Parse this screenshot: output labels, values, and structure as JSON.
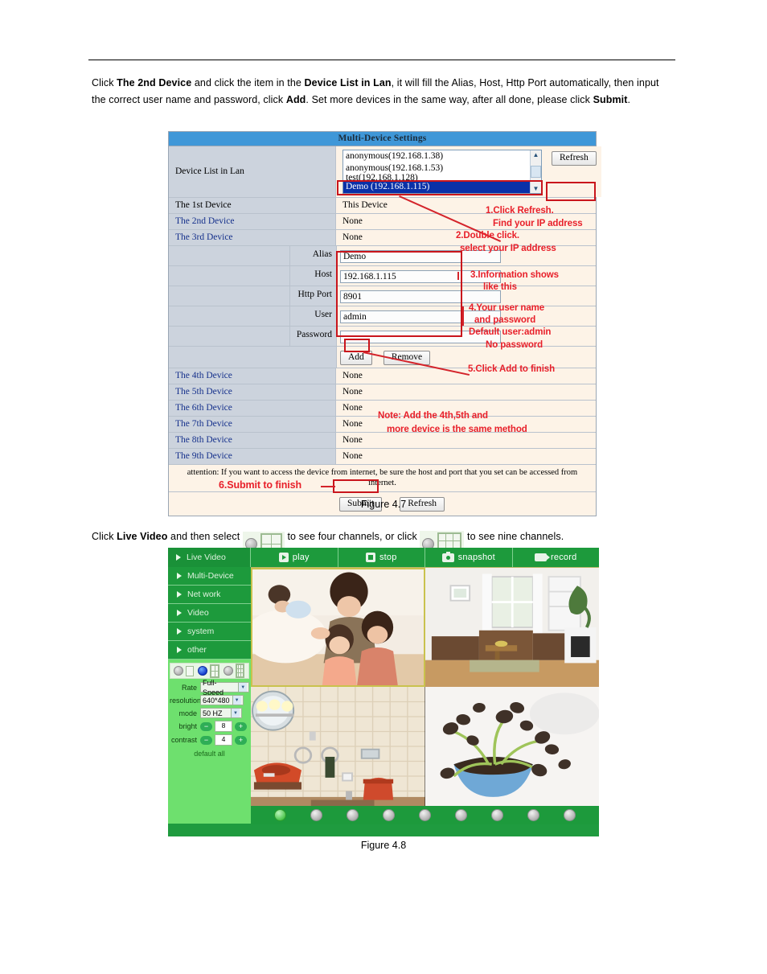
{
  "document": {
    "intro_paragraph": {
      "segments": [
        {
          "t": "Click ",
          "b": false
        },
        {
          "t": "The 2nd Device",
          "b": true
        },
        {
          "t": " and click the item in the ",
          "b": false
        },
        {
          "t": "Device List in Lan",
          "b": true
        },
        {
          "t": ", it will fill the Alias, Host, Http Port automatically, then input the correct user name and password, click ",
          "b": false
        },
        {
          "t": "Add",
          "b": true
        },
        {
          "t": ". Set more devices in the same way, after all done, please click ",
          "b": false
        },
        {
          "t": "Submit",
          "b": true
        },
        {
          "t": ".",
          "b": false
        }
      ]
    },
    "live_paragraph": {
      "before_first_icon": "Click ",
      "bold_live_video": "Live Video",
      "after_bold": " and then select ",
      "between_icons": " to see four channels, or click ",
      "after_second_icon": " to see nine channels."
    },
    "figure_47_caption": "Figure 4.7",
    "figure_48_caption": "Figure 4.8"
  },
  "multi_device": {
    "title": "Multi-Device Settings",
    "device_list_label": "Device List in Lan",
    "device_list_options": [
      "anonymous(192.168.1.38)",
      "anonymous(192.168.1.53)",
      "test(192.168.1.128)",
      "Demo (192.168.1.115)"
    ],
    "device_list_selected": "Demo (192.168.1.115)",
    "refresh_label": "Refresh",
    "devices": [
      {
        "label": "The 1st Device",
        "value": "This Device",
        "is_link": false
      },
      {
        "label": "The 2nd Device",
        "value": "None",
        "is_link": true
      },
      {
        "label": "The 3rd Device",
        "value": "None",
        "is_link": true
      }
    ],
    "devices_tail": [
      {
        "label": "The 4th Device",
        "value": "None",
        "is_link": true
      },
      {
        "label": "The 5th Device",
        "value": "None",
        "is_link": true
      },
      {
        "label": "The 6th Device",
        "value": "None",
        "is_link": true
      },
      {
        "label": "The 7th Device",
        "value": "None",
        "is_link": true
      },
      {
        "label": "The 8th Device",
        "value": "None",
        "is_link": true
      },
      {
        "label": "The 9th Device",
        "value": "None",
        "is_link": true
      }
    ],
    "form": {
      "alias_label": "Alias",
      "alias_value": "Demo",
      "host_label": "Host",
      "host_value": "192.168.1.115",
      "http_port_label": "Http Port",
      "http_port_value": "8901",
      "user_label": "User",
      "user_value": "admin",
      "password_label": "Password",
      "password_value": ""
    },
    "add_label": "Add",
    "remove_label": "Remove",
    "attention": "attention: If you want to access the device from internet, be sure the host and port that you set can be accessed from internet.",
    "submit_label": "Submit",
    "bottom_refresh_label": "Refresh",
    "annotations": [
      {
        "id": "a1",
        "text": "1.Click Refresh."
      },
      {
        "id": "a1b",
        "text": "Find your IP address"
      },
      {
        "id": "a2",
        "text": "2.Double click."
      },
      {
        "id": "a2b",
        "text": "select your IP address"
      },
      {
        "id": "a3",
        "text": "3.Information shows"
      },
      {
        "id": "a3b",
        "text": "like this"
      },
      {
        "id": "a4",
        "text": "4.Your user name"
      },
      {
        "id": "a4b",
        "text": "and password"
      },
      {
        "id": "a4c",
        "text": "Default user:admin"
      },
      {
        "id": "a4d",
        "text": "No password"
      },
      {
        "id": "a5",
        "text": "5.Click Add to finish"
      },
      {
        "id": "a6",
        "text": "Note: Add the 4th,5th and"
      },
      {
        "id": "a6b",
        "text": "more device is the same method"
      },
      {
        "id": "a7",
        "text": "6.Submit to finish"
      }
    ],
    "annotation_color": "#e8202a"
  },
  "live_video": {
    "toolbar": [
      {
        "label": "play",
        "icon": "play-icon"
      },
      {
        "label": "stop",
        "icon": "stop-icon"
      },
      {
        "label": "snapshot",
        "icon": "camera-icon"
      },
      {
        "label": "record",
        "icon": "video-camera-icon"
      }
    ],
    "menu": [
      {
        "label": "Live Video"
      },
      {
        "label": "Multi-Device"
      },
      {
        "label": "Net work"
      },
      {
        "label": "Video"
      },
      {
        "label": "system"
      },
      {
        "label": "other"
      }
    ],
    "view_modes": [
      {
        "name": "single",
        "selected": false
      },
      {
        "name": "four",
        "selected": true
      },
      {
        "name": "nine",
        "selected": false
      }
    ],
    "controls": {
      "rate_label": "Rate",
      "rate_value": "Full-Speed",
      "resolution_label": "resolution",
      "resolution_value": "640*480",
      "mode_label": "mode",
      "mode_value": "50 HZ",
      "bright_label": "bright",
      "bright_value": "8",
      "contrast_label": "contrast",
      "contrast_value": "4",
      "default_all_label": "default all",
      "minus": "−",
      "plus": "+"
    },
    "channels": [
      {
        "index": 1,
        "active": true
      },
      {
        "index": 2,
        "active": false
      },
      {
        "index": 3,
        "active": false
      },
      {
        "index": 4,
        "active": false
      },
      {
        "index": 5,
        "active": false
      },
      {
        "index": 6,
        "active": false
      },
      {
        "index": 7,
        "active": false
      },
      {
        "index": 8,
        "active": false
      },
      {
        "index": 9,
        "active": false
      }
    ],
    "green_accent": "#1d9a3c",
    "panel_green": "#6ee06e"
  }
}
